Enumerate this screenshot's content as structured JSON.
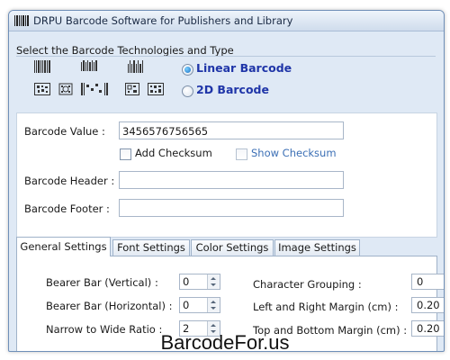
{
  "window": {
    "title": "DRPU Barcode Software for Publishers and Library"
  },
  "technology": {
    "section_label": "Select the Barcode Technologies and Type",
    "linear_label": "Linear Barcode",
    "twod_label": "2D Barcode",
    "selected": "Linear Barcode"
  },
  "barcode": {
    "value_label": "Barcode Value :",
    "value": "3456576756565",
    "add_checksum_label": "Add Checksum",
    "add_checksum_checked": false,
    "show_checksum_label": "Show Checksum",
    "show_checksum_checked": false,
    "header_label": "Barcode Header :",
    "header_value": "",
    "footer_label": "Barcode Footer :",
    "footer_value": ""
  },
  "tabs": [
    {
      "label": "General Settings",
      "active": true
    },
    {
      "label": "Font Settings",
      "active": false
    },
    {
      "label": "Color Settings",
      "active": false
    },
    {
      "label": "Image Settings",
      "active": false
    }
  ],
  "general": {
    "bearer_vertical_label": "Bearer Bar (Vertical) :",
    "bearer_vertical_value": "0",
    "bearer_horizontal_label": "Bearer Bar (Horizontal) :",
    "bearer_horizontal_value": "0",
    "narrow_wide_label": "Narrow to Wide Ratio :",
    "narrow_wide_value": "2",
    "char_grouping_label": "Character Grouping  :",
    "char_grouping_value": "0",
    "lr_margin_label": "Left and Right Margin (cm) :",
    "lr_margin_value": "0.20",
    "tb_margin_label": "Top and Bottom Margin (cm) :",
    "tb_margin_value": "0.20"
  },
  "watermark": "BarcodeFor.us"
}
